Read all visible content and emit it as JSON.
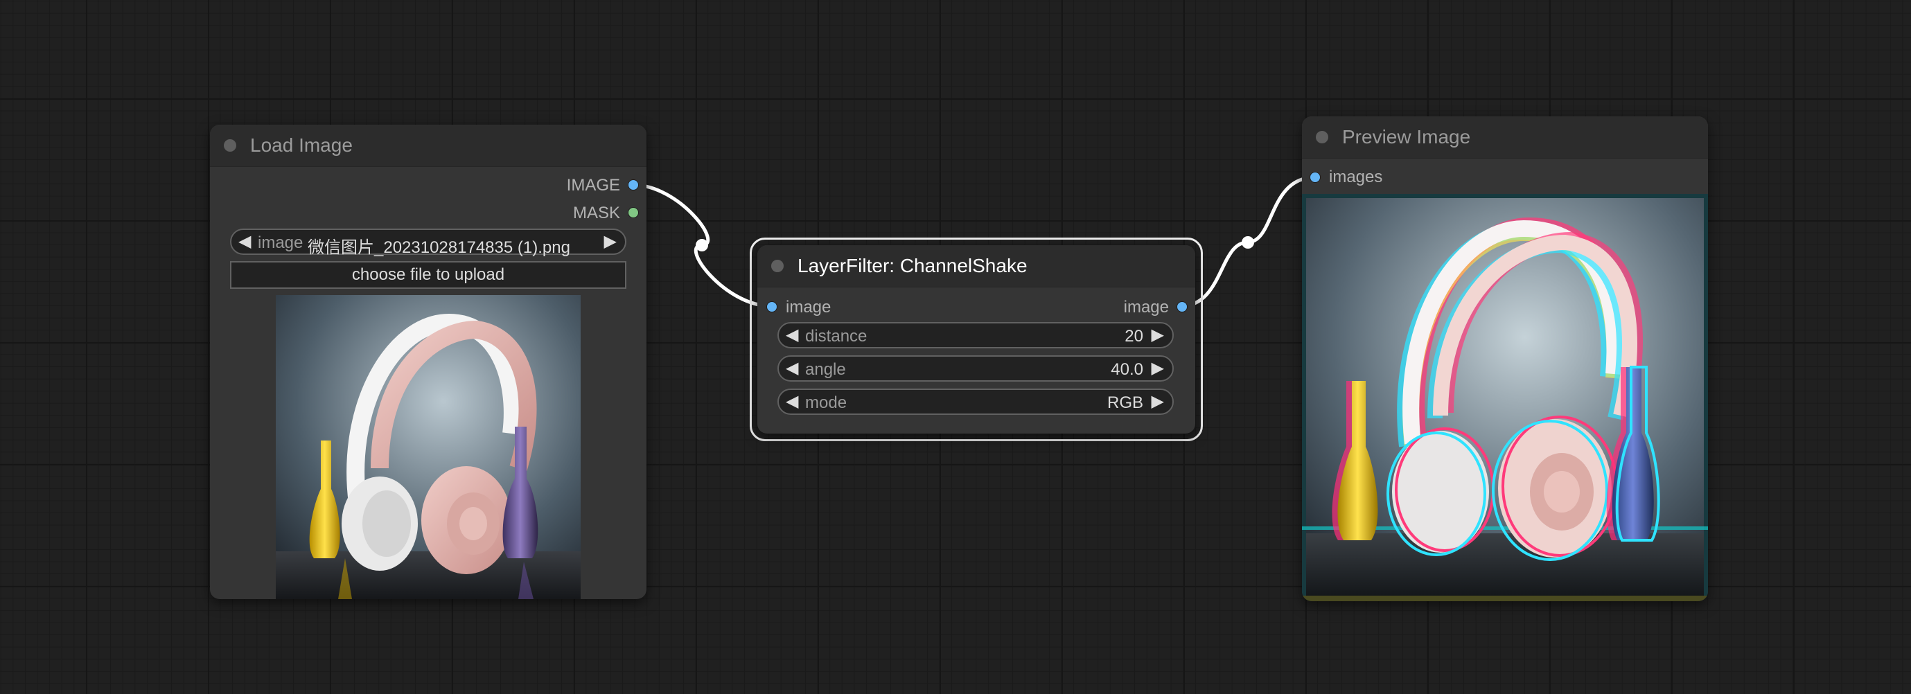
{
  "nodes": {
    "load_image": {
      "title": "Load Image",
      "outputs": [
        {
          "label": "IMAGE",
          "color": "#64b5f6"
        },
        {
          "label": "MASK",
          "color": "#81c784"
        }
      ],
      "widget": {
        "name": "image",
        "value": "微信图片_20231028174835 (1).png"
      },
      "upload_button": "choose file to upload"
    },
    "channel_shake": {
      "title": "LayerFilter: ChannelShake",
      "input": {
        "label": "image",
        "color": "#64b5f6"
      },
      "output": {
        "label": "image",
        "color": "#64b5f6"
      },
      "widgets": [
        {
          "name": "distance",
          "value": "20"
        },
        {
          "name": "angle",
          "value": "40.0"
        },
        {
          "name": "mode",
          "value": "RGB"
        }
      ]
    },
    "preview_image": {
      "title": "Preview Image",
      "input": {
        "label": "images",
        "color": "#64b5f6"
      }
    }
  },
  "icons": {
    "decrement": "left-triangle-icon",
    "increment": "right-triangle-icon"
  },
  "theme": {
    "canvas_bg": "#202020",
    "node_bg": "#353535",
    "node_header_bg": "#2c2c2c",
    "link_color": "#ffffff",
    "image_slot_color": "#64b5f6",
    "mask_slot_color": "#81c784"
  }
}
